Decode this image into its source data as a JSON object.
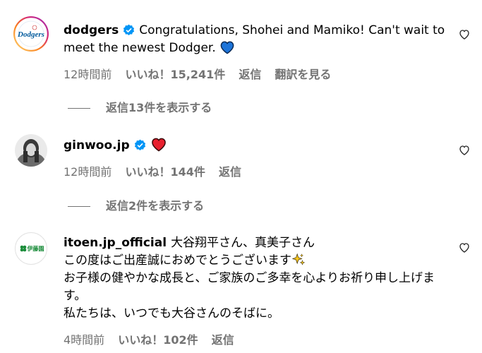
{
  "comments": [
    {
      "username": "dodgers",
      "verified": true,
      "text": "Congratulations, Shohei and Mamiko! Can't wait to meet the newest Dodger.",
      "emoji": "blue-heart-icon",
      "time": "12時間前",
      "likes": "いいね！15,241件",
      "reply": "返信",
      "translate": "翻訳を見る",
      "view_replies": "返信13件を表示する"
    },
    {
      "username": "ginwoo.jp",
      "verified": true,
      "text": "",
      "emoji": "red-heart-icon",
      "time": "12時間前",
      "likes": "いいね！144件",
      "reply": "返信",
      "view_replies": "返信2件を表示する"
    },
    {
      "username": "itoen.jp_official",
      "verified": false,
      "lines": [
        "大谷翔平さん、真美子さん",
        "この度はご出産誠におめでとうございます",
        "お子様の健やかな成長と、ご家族のご多幸を心よりお祈り申し上げます。",
        "私たちは、いつでも大谷さんのそばに。"
      ],
      "emoji": "sparkles-icon",
      "avatar_text": "伊藤園",
      "time": "4時間前",
      "likes": "いいね！102件",
      "reply": "返信"
    }
  ],
  "colors": {
    "verified": "#0095f6",
    "muted": "#737373",
    "dodgers_blue": "#005a9c",
    "ring_start": "#f58529",
    "ring_end": "#dd2a7b"
  }
}
